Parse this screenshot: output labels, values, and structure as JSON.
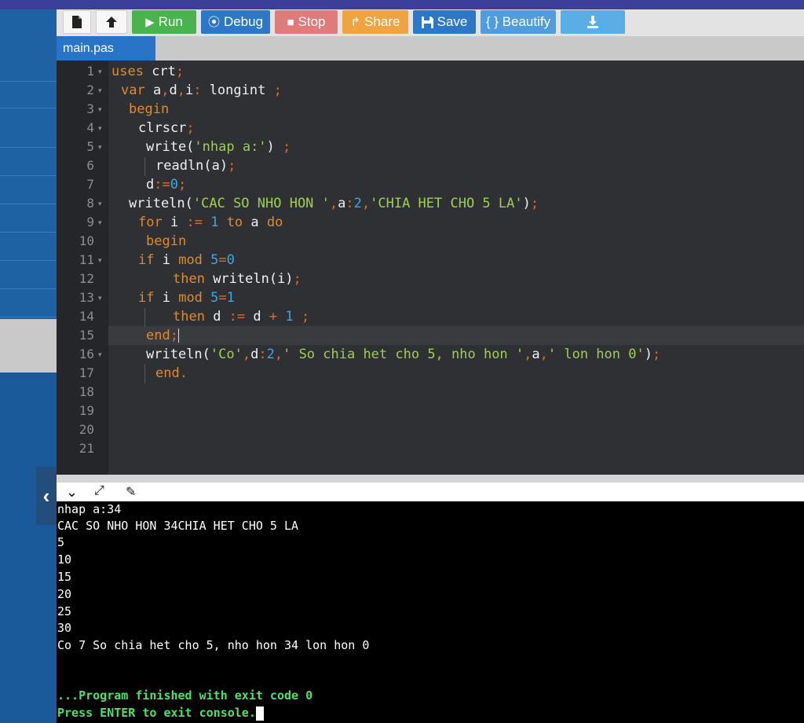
{
  "toolbar": {
    "file_icon": "file-icon",
    "upload_icon": "upload-icon",
    "run_label": "Run",
    "debug_label": "Debug",
    "stop_label": "Stop",
    "share_label": "Share",
    "save_label": "Save",
    "beautify_label": "{ } Beautify",
    "download_icon": "download-icon",
    "colors": {
      "run": "#49b34d",
      "debug": "#2c78c6",
      "stop": "#e07b7b",
      "share": "#f0a440",
      "save": "#2c78c6",
      "beautify": "#4f9ddf",
      "download": "#5aaee6"
    }
  },
  "tabs": [
    {
      "label": "main.pas"
    }
  ],
  "editor": {
    "line_numbers": [
      "1",
      "2",
      "3",
      "4",
      "5",
      "6",
      "7",
      "8",
      "9",
      "10",
      "11",
      "12",
      "13",
      "14",
      "15",
      "16",
      "17",
      "18",
      "19",
      "20",
      "21"
    ],
    "lines": [
      "uses crt;",
      "var a,d,i: longint ;",
      "begin",
      "clrscr;",
      "write('nhap a:') ;",
      "readln(a);",
      "d:=0;",
      "writeln('CAC SO NHO HON ',a:2,'CHIA HET CHO 5 LA');",
      "for i := 1 to a do",
      "begin",
      "if i mod 5=0",
      "then writeln(i);",
      "if i mod 5=1",
      "then d := d + 1 ;",
      "end;",
      "writeln('Co',d:2,' So chia het cho 5, nho hon ',a,' lon hon 0');",
      "end.",
      "",
      "",
      "",
      ""
    ],
    "active_line": "15"
  },
  "console_toolbar": {
    "collapse_icon": "chevron-down-icon",
    "expand_icon": "expand-icon",
    "clear_icon": "clear-console-icon"
  },
  "console": {
    "lines": [
      "nhap a:34",
      "CAC SO NHO HON 34CHIA HET CHO 5 LA",
      "5",
      "10",
      "15",
      "20",
      "25",
      "30",
      "Co 7 So chia het cho 5, nho hon 34 lon hon 0",
      "",
      "",
      "...Program finished with exit code 0",
      "Press ENTER to exit console."
    ]
  },
  "sidebar": {
    "collapse_icon": "chevron-left-icon"
  }
}
